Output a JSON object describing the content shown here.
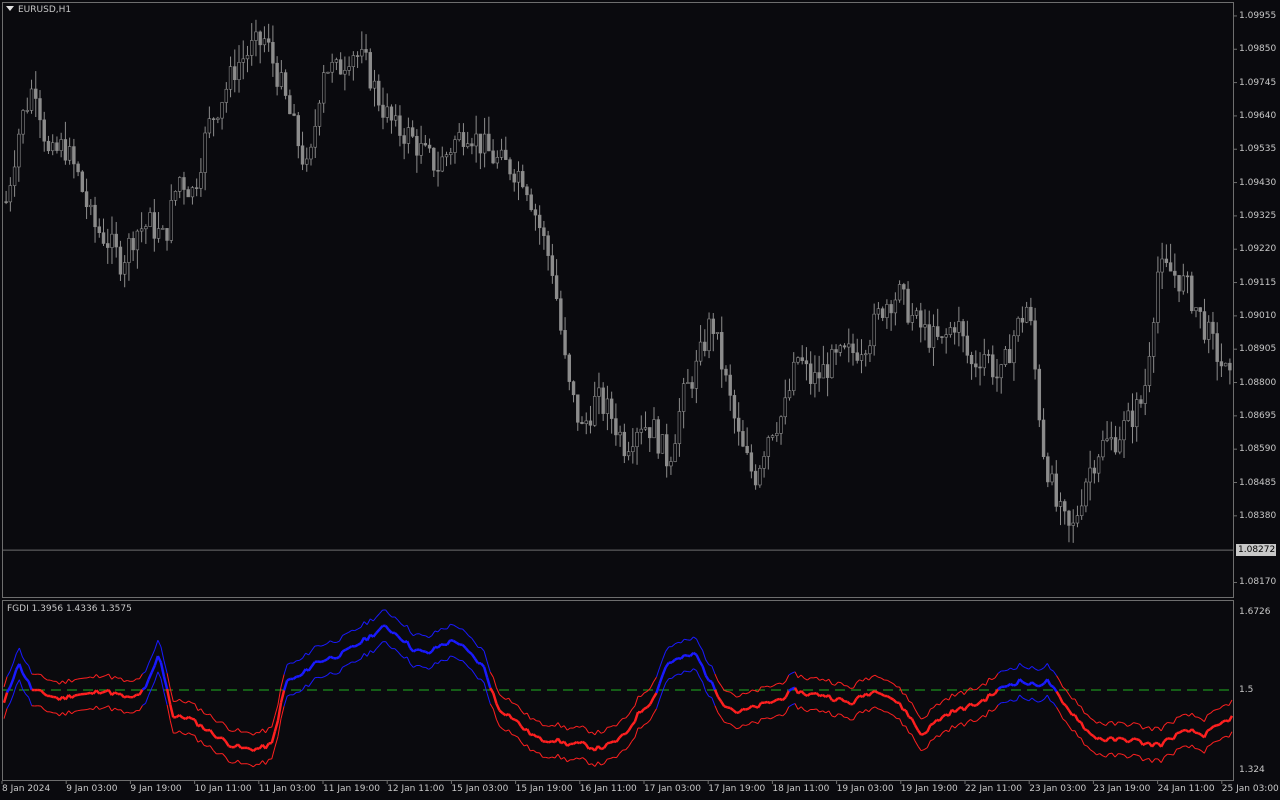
{
  "chart_window": {
    "title": "EURUSD,H1",
    "current_price_label": "1.08272"
  },
  "indicator": {
    "title": "FGDI 1.3956 1.4336 1.3575",
    "axis_labels": [
      "1.6726",
      "1.5",
      "1.324"
    ],
    "level": 1.5
  },
  "colors": {
    "background": "#0a0a0e",
    "candle": "#8c8c8c",
    "upper_color": "#1a1aff",
    "lower_color": "#ff2020",
    "level_color": "#20b020"
  },
  "chart_data": [
    {
      "type": "candlestick",
      "title": "EURUSD,H1",
      "y_ticks": [
        "1.09955",
        "1.09850",
        "1.09745",
        "1.09640",
        "1.09535",
        "1.09430",
        "1.09325",
        "1.09220",
        "1.09115",
        "1.09010",
        "1.08905",
        "1.08800",
        "1.08695",
        "1.08590",
        "1.08485",
        "1.08380",
        "1.08170"
      ],
      "ylim": [
        1.0814,
        1.0998
      ],
      "x_ticks": [
        "8 Jan 2024",
        "9 Jan 03:00",
        "9 Jan 19:00",
        "10 Jan 11:00",
        "11 Jan 03:00",
        "11 Jan 19:00",
        "12 Jan 11:00",
        "15 Jan 03:00",
        "15 Jan 19:00",
        "16 Jan 11:00",
        "17 Jan 03:00",
        "17 Jan 19:00",
        "18 Jan 11:00",
        "19 Jan 03:00",
        "19 Jan 19:00",
        "22 Jan 11:00",
        "23 Jan 03:00",
        "23 Jan 19:00",
        "24 Jan 11:00",
        "25 Jan 03:00"
      ],
      "close_path": [
        1.0937,
        1.0962,
        1.0975,
        1.095,
        1.0955,
        1.0945,
        1.093,
        1.0925,
        1.0918,
        1.0928,
        1.093,
        1.0925,
        1.0945,
        1.094,
        1.096,
        1.097,
        1.098,
        1.0985,
        1.0988,
        1.0975,
        1.096,
        1.0945,
        1.098,
        1.0978,
        1.0985,
        1.098,
        1.0968,
        1.096,
        1.0958,
        1.0952,
        1.0948,
        1.0955,
        1.096,
        1.0955,
        1.095,
        1.0948,
        1.0945,
        1.093,
        1.0915,
        1.088,
        1.0865,
        1.0875,
        1.087,
        1.086,
        1.0868,
        1.0865,
        1.0855,
        1.0875,
        1.0885,
        1.09,
        1.088,
        1.086,
        1.085,
        1.0865,
        1.087,
        1.0888,
        1.088,
        1.0885,
        1.0888,
        1.089,
        1.0895,
        1.0905,
        1.0908,
        1.09,
        1.0895,
        1.0892,
        1.09,
        1.0885,
        1.089,
        1.088,
        1.0895,
        1.0905,
        1.086,
        1.084,
        1.0832,
        1.085,
        1.086,
        1.0862,
        1.0868,
        1.0875,
        1.0915,
        1.0915,
        1.091,
        1.09,
        1.089,
        1.088
      ]
    },
    {
      "type": "line",
      "title": "FGDI 1.3956 1.4336 1.3575",
      "ylim": [
        1.31,
        1.69
      ],
      "series": [
        {
          "name": "",
          "color": "blue_red",
          "values": [
            1.47,
            1.56,
            1.5,
            1.49,
            1.48,
            1.49,
            1.49,
            1.5,
            1.49,
            1.48,
            1.5,
            1.58,
            1.44,
            1.44,
            1.42,
            1.4,
            1.38,
            1.37,
            1.37,
            1.38,
            1.52,
            1.53,
            1.56,
            1.57,
            1.58,
            1.6,
            1.62,
            1.64,
            1.62,
            1.59,
            1.58,
            1.6,
            1.61,
            1.58,
            1.55,
            1.46,
            1.44,
            1.41,
            1.39,
            1.39,
            1.38,
            1.38,
            1.37,
            1.38,
            1.4,
            1.45,
            1.48,
            1.56,
            1.57,
            1.58,
            1.52,
            1.47,
            1.45,
            1.46,
            1.47,
            1.48,
            1.5,
            1.49,
            1.49,
            1.48,
            1.47,
            1.49,
            1.5,
            1.48,
            1.45,
            1.4,
            1.43,
            1.45,
            1.46,
            1.47,
            1.49,
            1.51,
            1.52,
            1.51,
            1.52,
            1.47,
            1.44,
            1.4,
            1.39,
            1.39,
            1.39,
            1.38,
            1.38,
            1.4,
            1.41,
            1.4,
            1.42,
            1.44
          ]
        }
      ]
    }
  ]
}
